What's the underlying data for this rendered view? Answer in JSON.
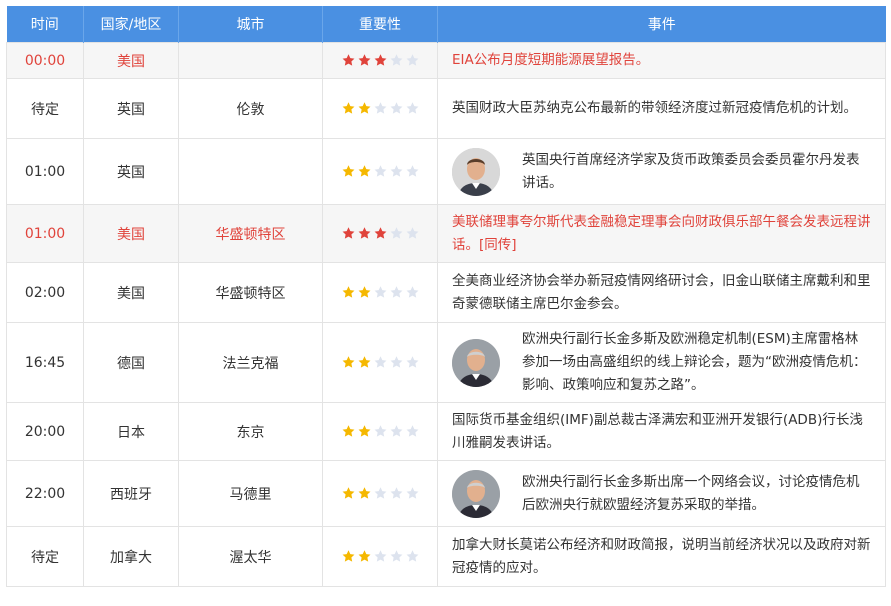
{
  "header": {
    "time": "时间",
    "country": "国家/地区",
    "city": "城市",
    "importance": "重要性",
    "event": "事件"
  },
  "colors": {
    "header_bg": "#4a90e2",
    "highlight_text": "#e0433b",
    "star_gold": "#f5b800",
    "star_red": "#e0433b",
    "star_empty": "#dde3ee"
  },
  "rows": [
    {
      "time": "00:00",
      "country": "美国",
      "city": "",
      "stars": 3,
      "highlight": true,
      "event": "EIA公布月度短期能源展望报告。",
      "avatar": null
    },
    {
      "time": "待定",
      "country": "英国",
      "city": "伦敦",
      "stars": 2,
      "highlight": false,
      "event": "英国财政大臣苏纳克公布最新的带领经济度过新冠疫情危机的计划。",
      "avatar": null
    },
    {
      "time": "01:00",
      "country": "英国",
      "city": "",
      "stars": 2,
      "highlight": false,
      "event": "英国央行首席经济学家及货币政策委员会委员霍尔丹发表讲话。",
      "avatar": "speaker-portrait-1"
    },
    {
      "time": "01:00",
      "country": "美国",
      "city": "华盛顿特区",
      "stars": 3,
      "highlight": true,
      "event": "美联储理事夸尔斯代表金融稳定理事会向财政俱乐部午餐会发表远程讲话。[同传]",
      "avatar": null
    },
    {
      "time": "02:00",
      "country": "美国",
      "city": "华盛顿特区",
      "stars": 2,
      "highlight": false,
      "event": "全美商业经济协会举办新冠疫情网络研讨会，旧金山联储主席戴利和里奇蒙德联储主席巴尔金参会。",
      "avatar": null
    },
    {
      "time": "16:45",
      "country": "德国",
      "city": "法兰克福",
      "stars": 2,
      "highlight": false,
      "event": "欧洲央行副行长金多斯及欧洲稳定机制(ESM)主席雷格林参加一场由高盛组织的线上辩论会，题为“欧洲疫情危机：影响、政策响应和复苏之路”。",
      "avatar": "speaker-portrait-2"
    },
    {
      "time": "20:00",
      "country": "日本",
      "city": "东京",
      "stars": 2,
      "highlight": false,
      "event": "国际货币基金组织(IMF)副总裁古泽满宏和亚洲开发银行(ADB)行长浅川雅嗣发表讲话。",
      "avatar": null
    },
    {
      "time": "22:00",
      "country": "西班牙",
      "city": "马德里",
      "stars": 2,
      "highlight": false,
      "event": "欧洲央行副行长金多斯出席一个网络会议，讨论疫情危机后欧洲央行就欧盟经济复苏采取的举措。",
      "avatar": "speaker-portrait-2"
    },
    {
      "time": "待定",
      "country": "加拿大",
      "city": "渥太华",
      "stars": 2,
      "highlight": false,
      "event": "加拿大财长莫诺公布经济和财政简报，说明当前经济状况以及政府对新冠疫情的应对。",
      "avatar": null
    }
  ]
}
